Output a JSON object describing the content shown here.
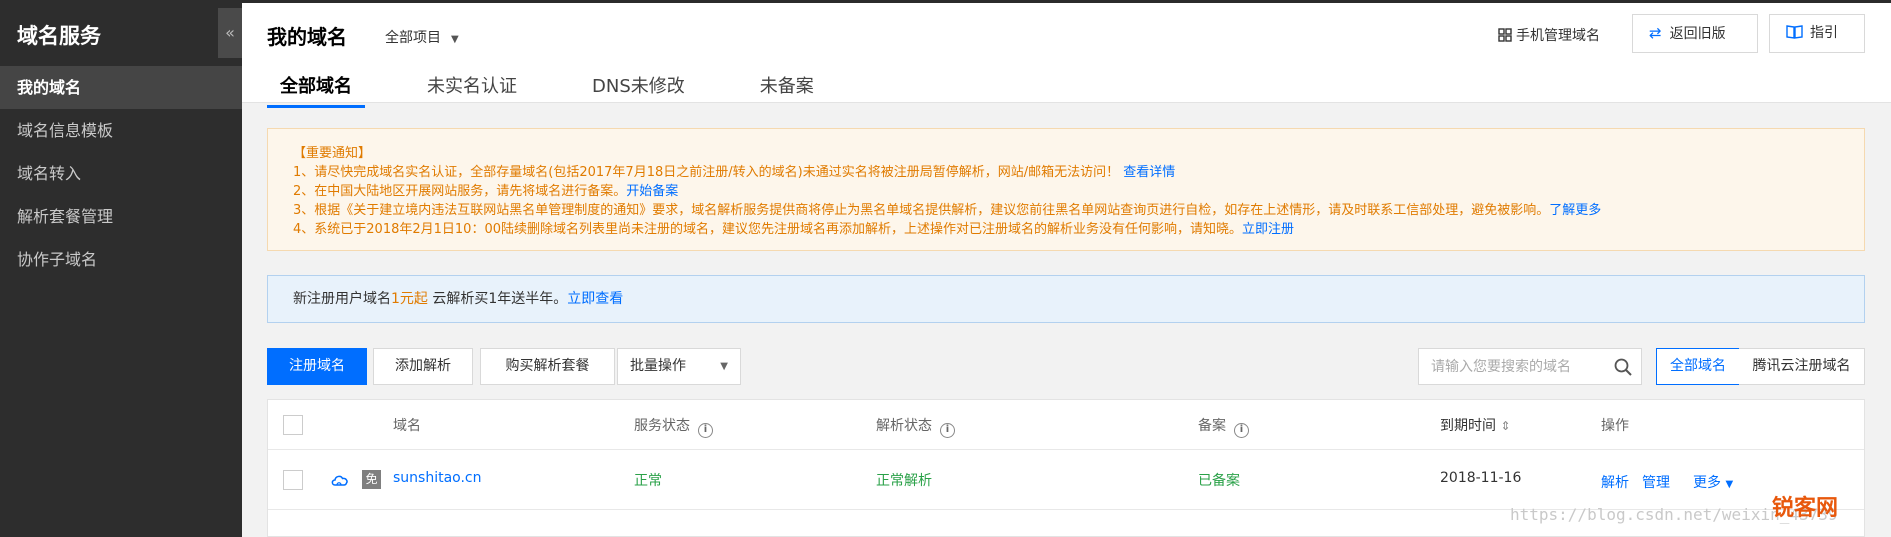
{
  "sidebar": {
    "title": "域名服务",
    "collapse_glyph": "«",
    "items": [
      {
        "label": "我的域名",
        "active": true
      },
      {
        "label": "域名信息模板",
        "active": false
      },
      {
        "label": "域名转入",
        "active": false
      },
      {
        "label": "解析套餐管理",
        "active": false
      },
      {
        "label": "协作子域名",
        "active": false
      }
    ]
  },
  "header": {
    "title": "我的域名",
    "project_select": "全部项目",
    "mobile_manage": "手机管理域名",
    "back_button": "返回旧版",
    "guide_button": "指引",
    "tabs": [
      "全部域名",
      "未实名认证",
      "DNS未修改",
      "未备案"
    ],
    "active_tab": 0
  },
  "notice": {
    "title": "【重要通知】",
    "line1_text": "1、请尽快完成域名实名认证，全部存量域名(包括2017年7月18日之前注册/转入的域名)未通过实名将被注册局暂停解析，网站/邮箱无法访问！",
    "line1_link": "查看详情",
    "line2_text": "2、在中国大陆地区开展网站服务，请先将域名进行备案。",
    "line2_link": "开始备案",
    "line3_text": "3、根据《关于建立境内违法互联网站黑名单管理制度的通知》要求，域名解析服务提供商将停止为黑名单域名提供解析，建议您前往黑名单网站查询页进行自检，如存在上述情形，请及时联系工信部处理，避免被影响。",
    "line3_link": "了解更多",
    "line4_text": "4、系统已于2018年2月1日10：00陆续删除域名列表里尚未注册的域名，建议您先注册域名再添加解析，上述操作对已注册域名的解析业务没有任何影响，请知晓。",
    "line4_link": "立即注册"
  },
  "promo": {
    "text_pre": "新注册用户域名",
    "highlight": "1元起",
    "text_post": " 云解析买1年送半年。",
    "link": "立即查看"
  },
  "toolbar": {
    "register": "注册域名",
    "add_dns": "添加解析",
    "buy_package": "购买解析套餐",
    "batch": "批量操作",
    "search_placeholder": "请输入您要搜索的域名",
    "filter_all": "全部域名",
    "filter_tencent": "腾讯云注册域名"
  },
  "table": {
    "columns": {
      "domain": "域名",
      "service_status": "服务状态",
      "dns_status": "解析状态",
      "icp": "备案",
      "expire": "到期时间",
      "sort_glyph": "⇕",
      "actions": "操作"
    },
    "rows": [
      {
        "badge": "免",
        "domain": "sunshitao.cn",
        "service_status": "正常",
        "dns_status": "正常解析",
        "icp": "已备案",
        "expire": "2018-11-16",
        "actions": [
          "解析",
          "管理",
          "更多"
        ]
      }
    ]
  },
  "watermark": "https://blog.csdn.net/weixin_43739",
  "logo_text": "锐客网",
  "colors": {
    "accent": "#006eff",
    "sidebar_bg": "#2d2d2d",
    "notice_text": "#e07b00",
    "status_green": "#2aa148"
  }
}
